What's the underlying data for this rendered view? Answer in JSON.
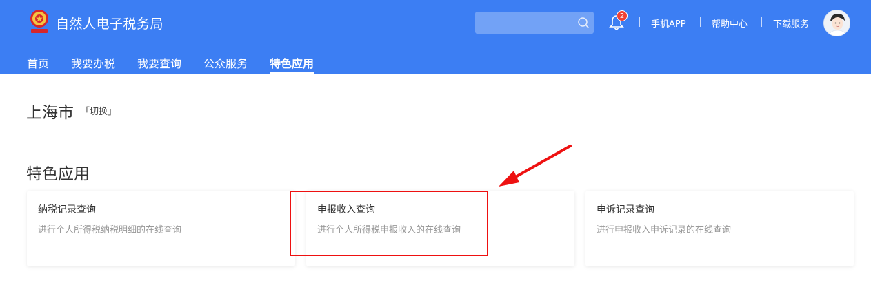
{
  "header": {
    "title": "自然人电子税务局",
    "logo_icon": "tax-emblem-icon",
    "search": {
      "placeholder": "",
      "icon": "search-icon"
    },
    "notifications": {
      "count": "2",
      "icon": "bell-icon"
    },
    "links": [
      "手机APP",
      "帮助中心",
      "下载服务"
    ],
    "avatar_icon": "user-avatar",
    "bg_color": "#3c7ef3"
  },
  "nav": {
    "items": [
      "首页",
      "我要办税",
      "我要查询",
      "公众服务",
      "特色应用"
    ],
    "active": "特色应用"
  },
  "location": {
    "city": "上海市",
    "switch_label": "「切换」"
  },
  "section": {
    "title": "特色应用"
  },
  "cards": [
    {
      "title": "纳税记录查询",
      "desc": "进行个人所得税纳税明细的在线查询"
    },
    {
      "title": "申报收入查询",
      "desc": "进行个人所得税申报收入的在线查询"
    },
    {
      "title": "申诉记录查询",
      "desc": "进行申报收入申诉记录的在线查询"
    }
  ],
  "annotation": {
    "highlighted_card": "申报收入查询",
    "color": "#e11111"
  }
}
